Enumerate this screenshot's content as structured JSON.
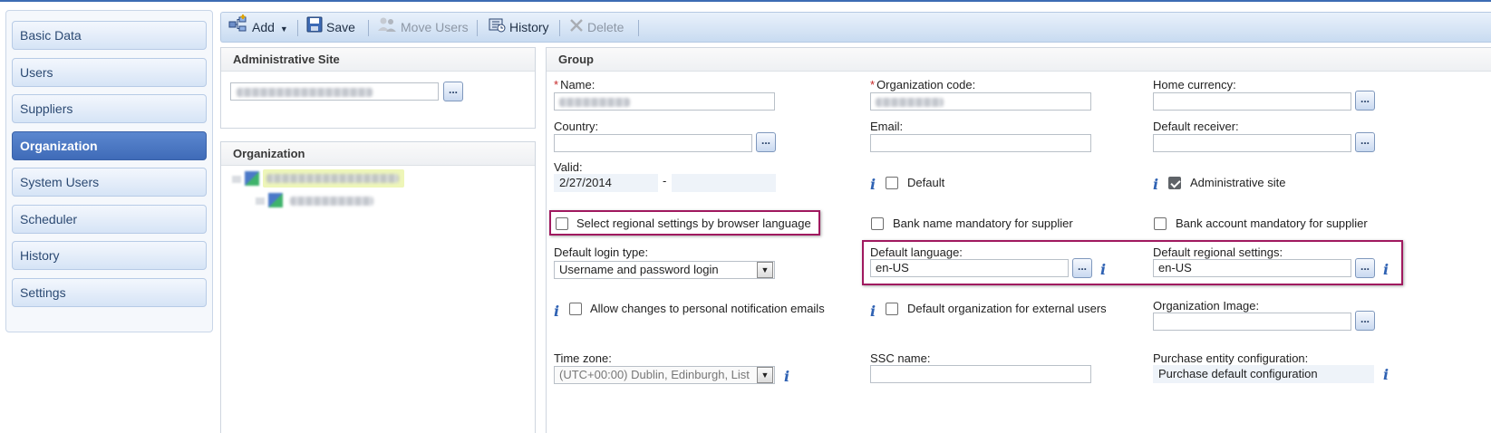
{
  "sidebar": {
    "items": [
      {
        "label": "Basic Data",
        "active": false
      },
      {
        "label": "Users",
        "active": false
      },
      {
        "label": "Suppliers",
        "active": false
      },
      {
        "label": "Organization",
        "active": true
      },
      {
        "label": "System Users",
        "active": false
      },
      {
        "label": "Scheduler",
        "active": false
      },
      {
        "label": "History",
        "active": false
      },
      {
        "label": "Settings",
        "active": false
      }
    ]
  },
  "toolbar": {
    "add_label": "Add",
    "save_label": "Save",
    "move_users_label": "Move Users",
    "history_label": "History",
    "delete_label": "Delete"
  },
  "admin_site": {
    "title": "Administrative Site",
    "dots": "..."
  },
  "org_tree": {
    "title": "Organization"
  },
  "group": {
    "title": "Group",
    "name_label": "Name:",
    "org_code_label": "Organization code:",
    "home_currency_label": "Home currency:",
    "country_label": "Country:",
    "email_label": "Email:",
    "default_receiver_label": "Default receiver:",
    "valid_label": "Valid:",
    "valid_from": "2/27/2014",
    "valid_sep": "-",
    "valid_to": "",
    "default_label": "Default",
    "admin_site_label": "Administrative site",
    "select_regional_label": "Select regional settings by browser language",
    "bank_name_label": "Bank name mandatory for supplier",
    "bank_account_label": "Bank account mandatory for supplier",
    "login_type_label": "Default login type:",
    "login_type_value": "Username and password login",
    "default_language_label": "Default language:",
    "default_language_value": "en-US",
    "regional_label": "Default regional settings:",
    "regional_value": "en-US",
    "allow_changes_label": "Allow changes to personal notification emails",
    "default_org_external_label": "Default organization for external users",
    "org_image_label": "Organization Image:",
    "time_zone_label": "Time zone:",
    "time_zone_value": "(UTC+00:00) Dublin, Edinburgh, List",
    "ssc_name_label": "SSC name:",
    "purchase_entity_label": "Purchase entity configuration:",
    "purchase_entity_value": "Purchase default configuration",
    "dots": "...",
    "info_glyph": "i",
    "required_mark": "*"
  },
  "icons": {
    "add": "add-hierarchy-icon",
    "save": "floppy-disk-icon",
    "move_users": "users-move-icon",
    "history": "history-book-icon",
    "delete": "x-delete-icon"
  },
  "colors": {
    "accent": "#3d6cb3",
    "active_nav": "#4a77c4",
    "highlight_box": "#a0195f",
    "info": "#2f62b3",
    "required": "#c62828"
  }
}
